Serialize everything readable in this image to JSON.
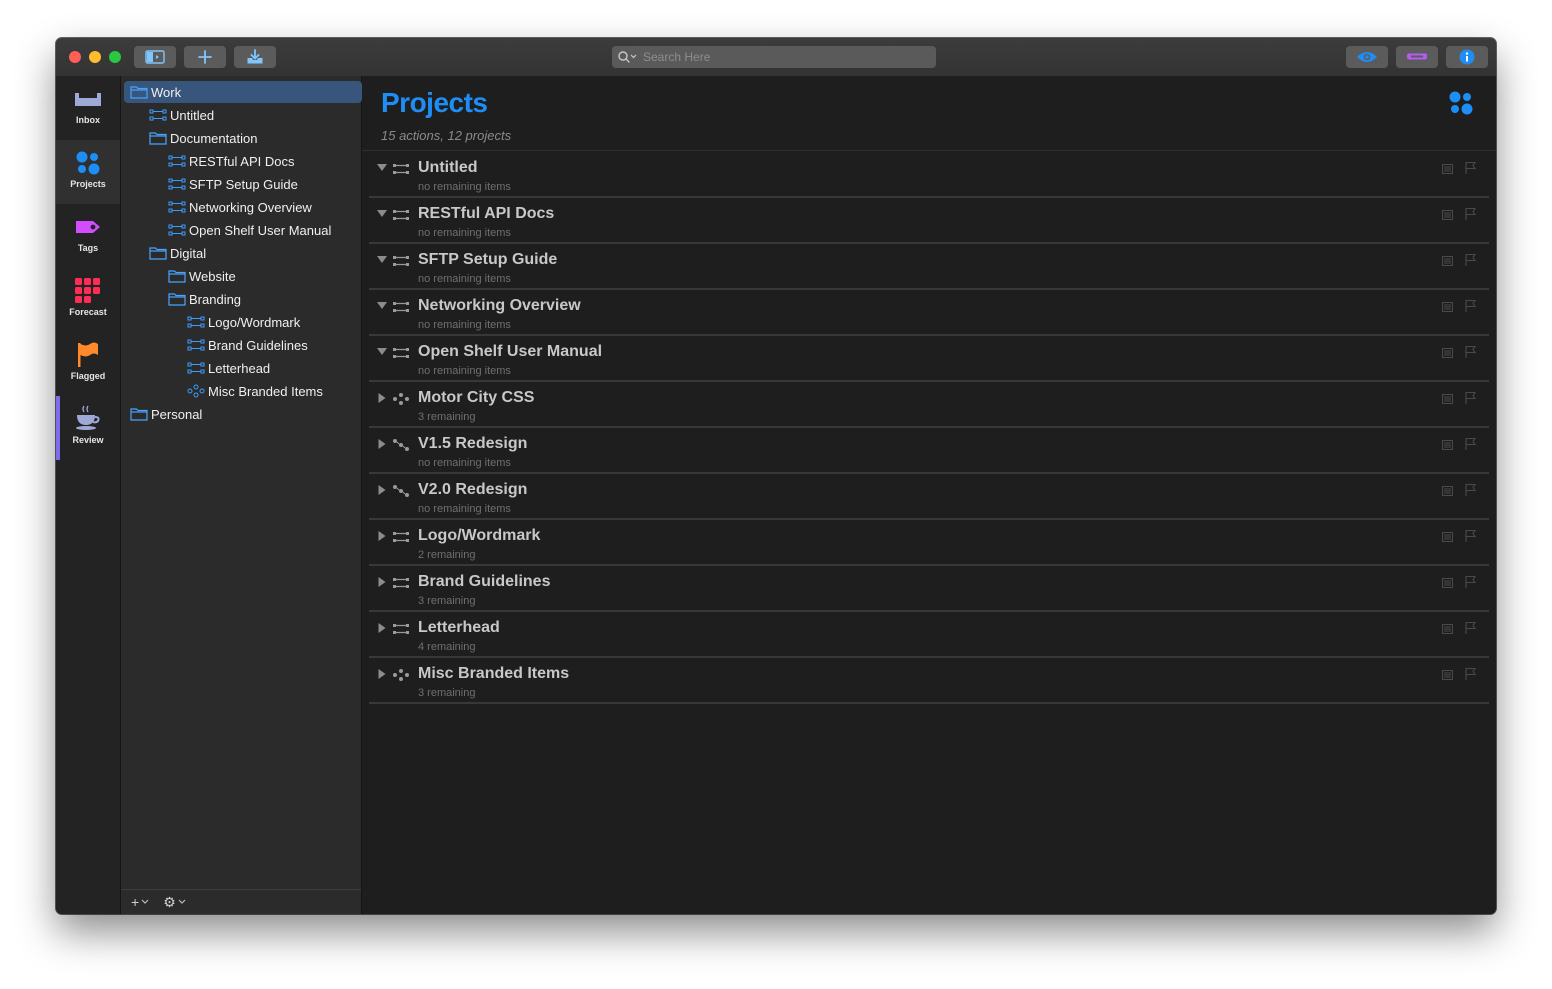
{
  "titlebar": {
    "search_placeholder": "Search Here",
    "buttons": [
      "sidebar-toggle-icon",
      "add-icon",
      "inbox-capture-icon",
      "view-eye-icon",
      "perspective-bar-icon",
      "info-icon"
    ]
  },
  "rail": {
    "items": [
      {
        "label": "Inbox",
        "icon": "inbox-icon"
      },
      {
        "label": "Projects",
        "icon": "projects-icon"
      },
      {
        "label": "Tags",
        "icon": "tag-icon"
      },
      {
        "label": "Forecast",
        "icon": "forecast-icon"
      },
      {
        "label": "Flagged",
        "icon": "flag-icon"
      },
      {
        "label": "Review",
        "icon": "review-cup-icon"
      }
    ],
    "selected": "Projects"
  },
  "sidebar": {
    "tree": [
      {
        "label": "Work",
        "kind": "folder",
        "depth": 0
      },
      {
        "label": "Untitled",
        "kind": "project",
        "depth": 1
      },
      {
        "label": "Documentation",
        "kind": "folder",
        "depth": 1
      },
      {
        "label": "RESTful API Docs",
        "kind": "project",
        "depth": 2
      },
      {
        "label": "SFTP Setup Guide",
        "kind": "project",
        "depth": 2
      },
      {
        "label": "Networking Overview",
        "kind": "project",
        "depth": 2
      },
      {
        "label": "Open Shelf User Manual",
        "kind": "project",
        "depth": 2
      },
      {
        "label": "Digital",
        "kind": "folder",
        "depth": 1
      },
      {
        "label": "Website",
        "kind": "folder",
        "depth": 2
      },
      {
        "label": "Branding",
        "kind": "folder",
        "depth": 2
      },
      {
        "label": "Logo/Wordmark",
        "kind": "project",
        "depth": 3
      },
      {
        "label": "Brand Guidelines",
        "kind": "project",
        "depth": 3
      },
      {
        "label": "Letterhead",
        "kind": "project",
        "depth": 3
      },
      {
        "label": "Misc Branded Items",
        "kind": "single-actions",
        "depth": 3
      },
      {
        "label": "Personal",
        "kind": "folder",
        "depth": 0
      }
    ],
    "selected": "Work",
    "footer": {
      "add_label": "+",
      "gear_label": "⚙"
    }
  },
  "main": {
    "title": "Projects",
    "subtitle": "15 actions, 12 projects",
    "projects": [
      {
        "title": "Untitled",
        "status": "no remaining items",
        "expanded": true,
        "kind": "sequential"
      },
      {
        "title": "RESTful API Docs",
        "status": "no remaining items",
        "expanded": true,
        "kind": "sequential"
      },
      {
        "title": "SFTP Setup Guide",
        "status": "no remaining items",
        "expanded": true,
        "kind": "sequential"
      },
      {
        "title": "Networking Overview",
        "status": "no remaining items",
        "expanded": true,
        "kind": "sequential"
      },
      {
        "title": "Open Shelf User Manual",
        "status": "no remaining items",
        "expanded": true,
        "kind": "sequential"
      },
      {
        "title": "Motor City CSS",
        "status": "3 remaining",
        "expanded": false,
        "kind": "single-actions"
      },
      {
        "title": "V1.5 Redesign",
        "status": "no remaining items",
        "expanded": false,
        "kind": "parallel"
      },
      {
        "title": "V2.0 Redesign",
        "status": "no remaining items",
        "expanded": false,
        "kind": "parallel"
      },
      {
        "title": "Logo/Wordmark",
        "status": "2 remaining",
        "expanded": false,
        "kind": "sequential"
      },
      {
        "title": "Brand Guidelines",
        "status": "3 remaining",
        "expanded": false,
        "kind": "sequential"
      },
      {
        "title": "Letterhead",
        "status": "4 remaining",
        "expanded": false,
        "kind": "sequential"
      },
      {
        "title": "Misc Branded Items",
        "status": "3 remaining",
        "expanded": false,
        "kind": "single-actions"
      }
    ]
  },
  "colors": {
    "accent_blue": "#1e8ef7",
    "selection": "#38557b",
    "review_accent": "#7b6cf0",
    "tags_purple": "#d14dff",
    "forecast_red": "#ff2d55",
    "flagged_orange": "#ff8a2b"
  }
}
